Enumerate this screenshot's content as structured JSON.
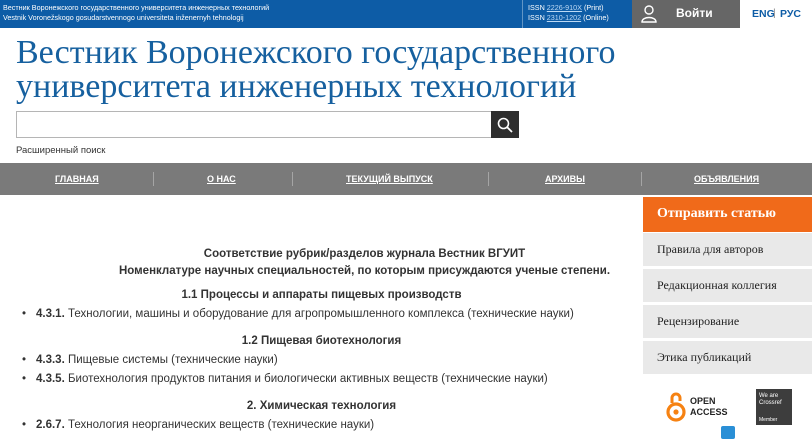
{
  "topbar": {
    "name_ru": "Вестник Воронежского государственного университета инженерных технологий",
    "name_lat": "Vestnik Voronežskogo gosudarstvennogo universiteta inženernyh tehnologij",
    "issn_print_prefix": "ISSN",
    "issn_print_number": "2226-910X",
    "issn_print_suffix": "(Print)",
    "issn_online_prefix": "ISSN",
    "issn_online_number": "2310-1202",
    "issn_online_suffix": "(Online)",
    "login_label": "Войти",
    "user_icon": "user-icon",
    "lang_eng": "ENG",
    "lang_sep": "|",
    "lang_rus": "РУС"
  },
  "header": {
    "title": "Вестник Воронежского государственного университета инженерных технологий",
    "search_placeholder": "",
    "search_icon": "search-icon",
    "advanced_search": "Расширенный поиск"
  },
  "nav": {
    "items": [
      "ГЛАВНАЯ",
      "О НАС",
      "ТЕКУЩИЙ ВЫПУСК",
      "АРХИВЫ",
      "ОБЪЯВЛЕНИЯ"
    ]
  },
  "sidebar": {
    "submit_label": "Отправить статью",
    "links": [
      "Правила для авторов",
      "Редакционная коллегия",
      "Рецензирование",
      "Этика публикаций"
    ],
    "open_access_line1": "OPEN",
    "open_access_line2": "ACCESS",
    "crossref_text": "We are Crossref",
    "crossref_member": "Member"
  },
  "content": {
    "heading_line1": "Соответствие рубрик/разделов журнала Вестник ВГУИТ",
    "heading_line2": "Номенклатуре научных специальностей, по которым присуждаются ученые степени.",
    "sections": [
      {
        "title": "1.1 Процессы и аппараты пищевых производств",
        "items": [
          {
            "code": "4.3.1.",
            "text": " Технологии, машины и оборудование для агропромышленного комплекса (технические науки)"
          }
        ]
      },
      {
        "title": "1.2 Пищевая биотехнология",
        "items": [
          {
            "code": "4.3.3.",
            "text": " Пищевые системы (технические науки)"
          },
          {
            "code": "4.3.5.",
            "text": " Биотехнология продуктов питания и биологически активных веществ (технические науки)"
          }
        ]
      },
      {
        "title": "2. Химическая технология",
        "items": [
          {
            "code": "2.6.7.",
            "text": " Технология неорганических веществ (технические науки)"
          }
        ]
      }
    ]
  },
  "colors": {
    "topbar": "#0d5ca6",
    "title": "#16609f",
    "nav": "#7a7a7a",
    "accent": "#f06a1a",
    "sidebar_link_bg": "#e9e9e9"
  }
}
